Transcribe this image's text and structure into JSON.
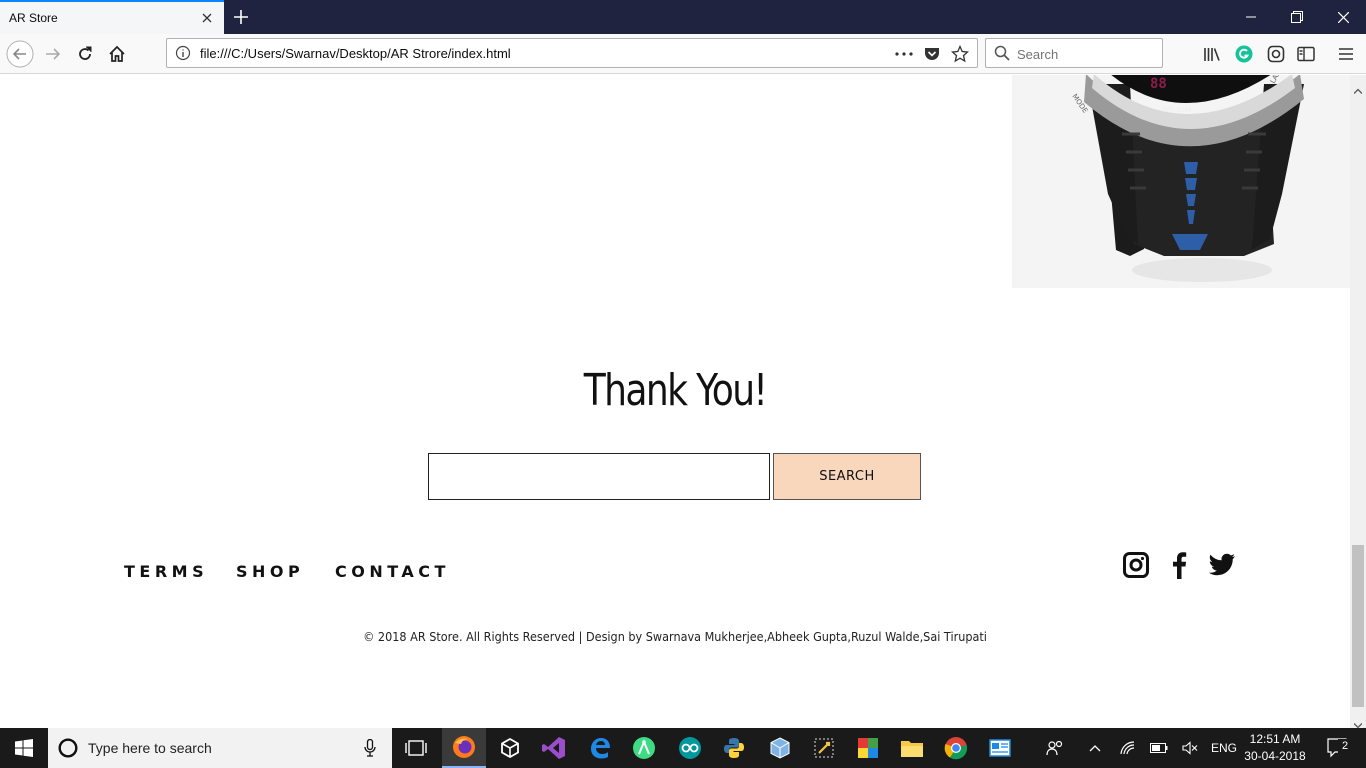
{
  "browser": {
    "tab_title": "AR Store",
    "url": "file:///C:/Users/Swarnav/Desktop/AR Strore/index.html",
    "search_placeholder": "Search"
  },
  "page": {
    "heading": "Thank You!",
    "search_button": "SEARCH",
    "search_value": "",
    "footer_links": [
      "TERMS",
      "SHOP",
      "CONTACT"
    ],
    "social_icons": [
      "instagram-icon",
      "facebook-icon",
      "twitter-icon"
    ],
    "copyright": "© 2018 AR Store. All Rights Reserved | Design by Swarnava Mukherjee,Abheek Gupta,Ruzul Walde,Sai Tirupati",
    "accent_color": "#f9d7bc"
  },
  "taskbar": {
    "search_placeholder": "Type here to search",
    "language": "ENG",
    "time": "12:51 AM",
    "date": "30-04-2018",
    "notification_count": "2"
  }
}
